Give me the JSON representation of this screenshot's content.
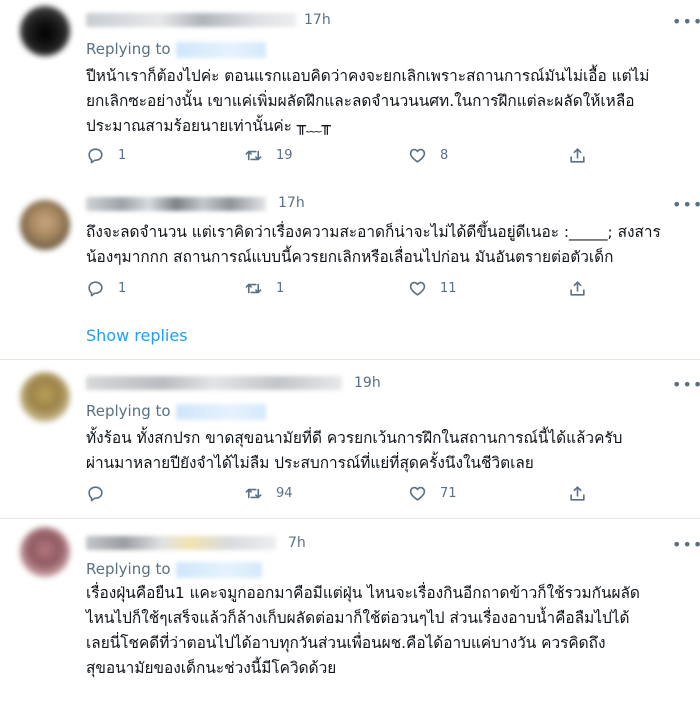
{
  "tweets": [
    {
      "time": "17h",
      "replying_label": "Replying to",
      "text": "ปีหน้าเราก็ต้องไปค่ะ ตอนแรกแอบคิดว่าคงจะยกเลิกเพราะสถานการณ์มันไม่เอื้อ แต่ไม่\nยกเลิกซะอย่างนั้น เขาแค่เพิ่มผลัดฝึกและลดจำนวนนศท.ในการฝึกแต่ละผลัดให้เหลือ\nประมาณสามร้อยนายเท่านั้นค่ะ ╥﹏╥",
      "counts": {
        "reply": "1",
        "retweet": "19",
        "like": "8"
      }
    },
    {
      "time": "17h",
      "replying_label": "",
      "text": "ถึงจะลดจำนวน แต่เราคิดว่าเรื่องความสะอาดก็น่าจะไม่ได้ดีขึ้นอยู่ดีเนอะ :_____; สงสาร\nน้องๆมากกก สถานการณ์แบบนี้ควรยกเลิกหรือเลื่อนไปก่อน มันอันตรายต่อตัวเด็ก",
      "counts": {
        "reply": "1",
        "retweet": "1",
        "like": "11"
      }
    },
    {
      "time": "19h",
      "replying_label": "Replying to",
      "text": "ทั้งร้อน ทั้งสกปรก ขาดสุขอนามัยที่ดี ควรยกเว้นการฝึกในสถานการณ์นี้ได้แล้วครับ\nผ่านมาหลายปียังจำได้ไม่ลืม ประสบการณ์ที่แย่ที่สุดครั้งนึงในชีวิตเลย",
      "counts": {
        "reply": "",
        "retweet": "94",
        "like": "71"
      }
    },
    {
      "time": "7h",
      "replying_label": "Replying to",
      "text": "เรื่องฝุ่นคือยืน1 แคะจมูกออกมาคือมีแต่ฝุ่น ไหนจะเรื่องกินอีกถาดข้าวก็ใช้รวมกันผลัด\nไหนไปก็ใช้ๆเสร็จแล้วก็ล้างเก็บผลัดต่อมาก็ใช้ต่อวนๆไป ส่วนเรื่องอาบน้ำคือลืมไปได้\nเลยนี่โชคดีที่ว่าตอนไปได้อาบทุกวันส่วนเพื่อนผช.คือได้อาบแค่บางวัน ควรคิดถึง\nสุขอนามัยของเด็กนะช่วงนี้มีโควิดด้วย",
      "counts": {
        "reply": "",
        "retweet": "",
        "like": ""
      }
    }
  ],
  "show_replies": "Show replies",
  "more_glyph": "•••",
  "icons": [
    "reply-icon",
    "retweet-icon",
    "like-icon",
    "share-icon",
    "more-icon"
  ],
  "colors": {
    "link": "#1da1f2",
    "secondary": "#5b7083",
    "divider": "#e1e8ed",
    "text": "#0f1419"
  }
}
